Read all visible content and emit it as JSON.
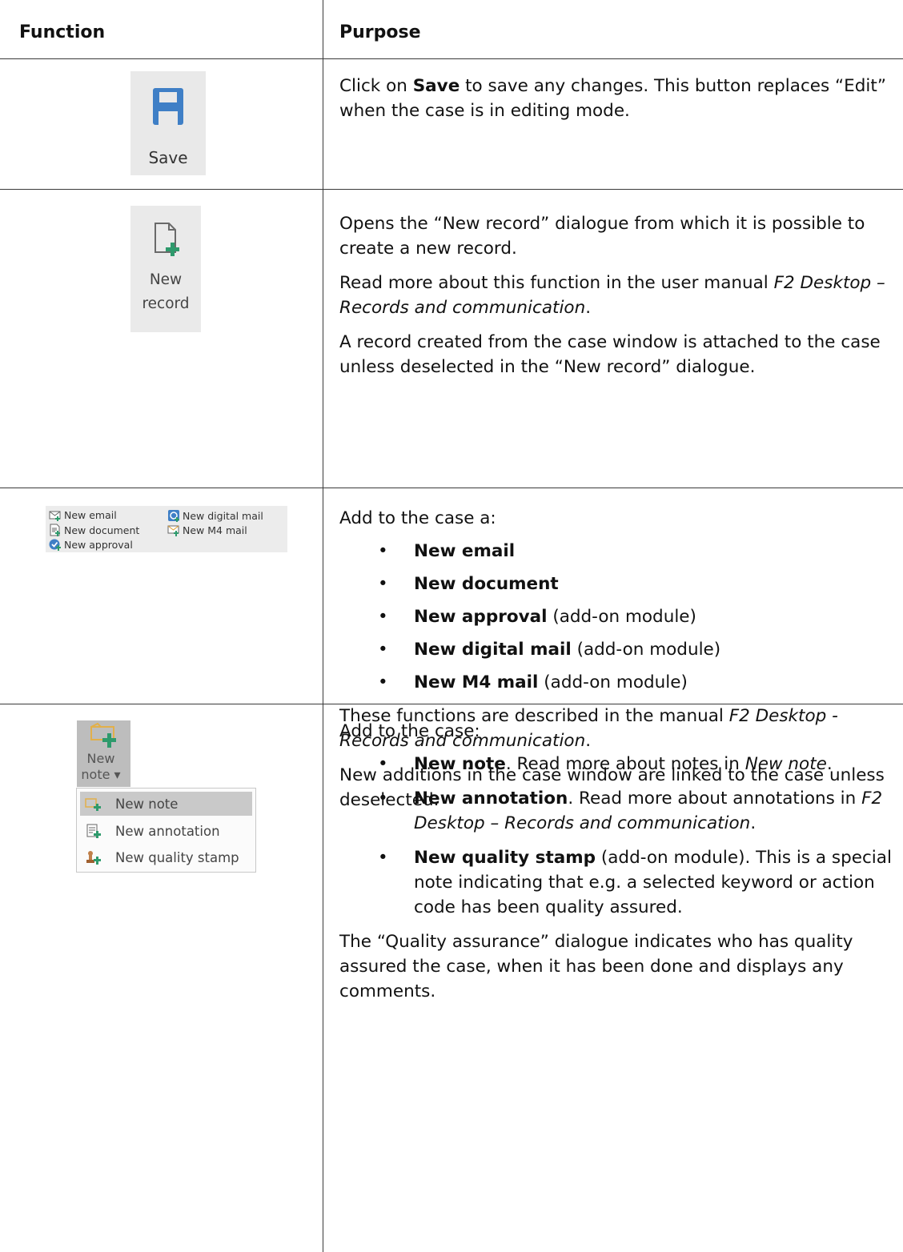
{
  "header": {
    "col1": "Function",
    "col2": "Purpose"
  },
  "save": {
    "button_label": "Save",
    "desc_pre": "Click on ",
    "desc_bold": "Save",
    "desc_post": " to save any changes. This button replaces “Edit” when the case is in editing mode."
  },
  "new_record": {
    "button_label_line1": "New",
    "button_label_line2": "record",
    "p1": "Opens the “New record” dialogue from which it is possible to create a new record.",
    "p2_pre": "Read more about this function in the user manual ",
    "p2_italic": "F2 Desktop – Records and communication",
    "p2_post": ".",
    "p3": "A record created from the case window is attached to the case unless deselected in the “New record” dialogue."
  },
  "ribbon": {
    "new_email": "New email",
    "new_digital_mail": "New digital mail",
    "new_document": "New document",
    "new_m4_mail": "New M4 mail",
    "new_approval": "New approval"
  },
  "additions": {
    "intro": "Add to the case a:",
    "items": [
      {
        "bold": "New email",
        "rest": ""
      },
      {
        "bold": "New document",
        "rest": ""
      },
      {
        "bold": "New approval",
        "rest": " (add-on module)"
      },
      {
        "bold": "New digital mail",
        "rest": " (add-on module)"
      },
      {
        "bold": "New M4 mail",
        "rest": " (add-on module)"
      }
    ],
    "p2_pre": "These functions are described in the manual ",
    "p2_italic": "F2 Desktop - Records and communication",
    "p2_post": ".",
    "p3": "New additions in the case window are linked to the case unless deselected."
  },
  "note_menu": {
    "button_line1": "New",
    "button_line2": "note ▾",
    "items": [
      "New note",
      "New annotation",
      "New quality stamp"
    ]
  },
  "notes": {
    "intro": "Add to the case:",
    "b1_bold": "New note",
    "b1_mid": ". Read more about notes in ",
    "b1_italic": "New note",
    "b1_end": ".",
    "b2_bold": "New annotation",
    "b2_mid": ". Read more about annotations in ",
    "b2_italic": "F2 Desktop – Records and communication",
    "b2_end": ".",
    "b3_bold": "New quality stamp",
    "b3_rest": " (add-on module). This is a special note indicating that e.g. a selected keyword or action code has been quality assured.",
    "p_end": "The “Quality assurance” dialogue indicates who has quality assured the case, when it has been done and displays any comments."
  }
}
